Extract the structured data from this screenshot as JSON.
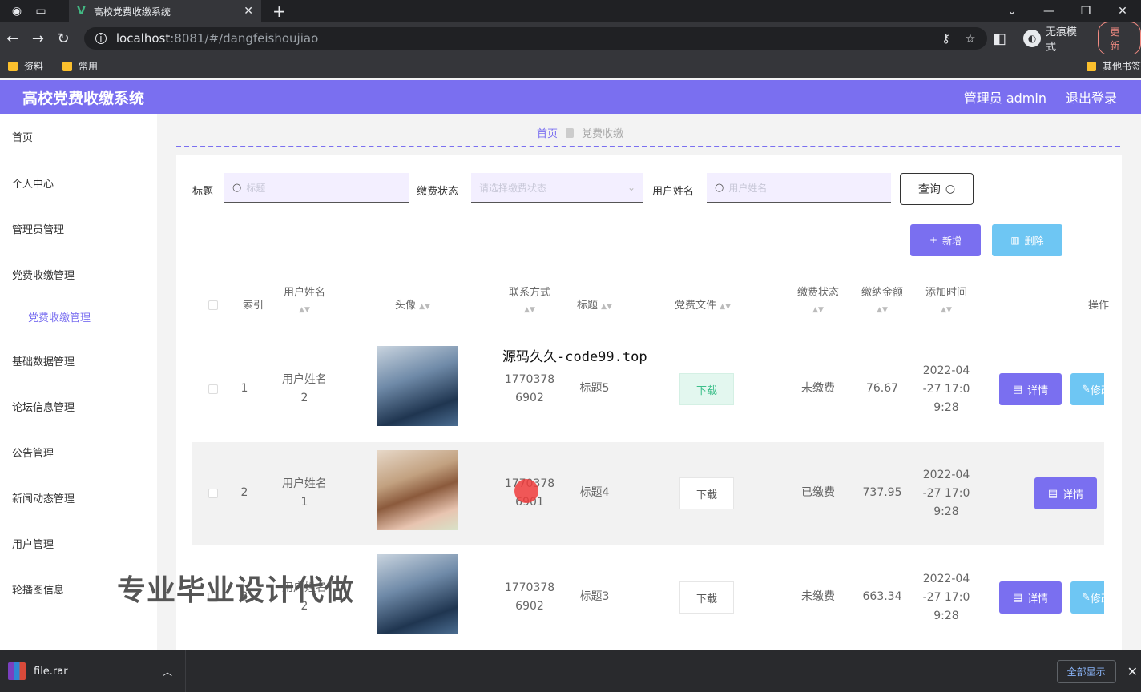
{
  "browser": {
    "tab_title": "高校党费收缴系统",
    "url_host": "localhost",
    "url_path": ":8081/#/dangfeishoujiao",
    "incognito_label": "无痕模式",
    "update_label": "更新",
    "bookmarks": [
      "资料",
      "常用"
    ],
    "bookmarks_other": "其他书签"
  },
  "header": {
    "title": "高校党费收缴系统",
    "user": "管理员 admin",
    "logout": "退出登录",
    "accent_color": "#7a6ff0"
  },
  "sidebar": {
    "items": [
      "首页",
      "个人中心",
      "管理员管理",
      "党费收缴管理",
      "党费收缴管理",
      "基础数据管理",
      "论坛信息管理",
      "公告管理",
      "新闻动态管理",
      "用户管理",
      "轮播图信息"
    ]
  },
  "breadcrumb": {
    "home": "首页",
    "current": "党费收缴"
  },
  "search": {
    "title_label": "标题",
    "title_placeholder": "标题",
    "status_label": "缴费状态",
    "status_placeholder": "请选择缴费状态",
    "name_label": "用户姓名",
    "name_placeholder": "用户姓名",
    "query_label": "查询"
  },
  "actions": {
    "add": "新增",
    "delete": "删除"
  },
  "table": {
    "headers": {
      "index": "索引",
      "username": "用户姓名",
      "avatar": "头像",
      "contact": "联系方式",
      "title": "标题",
      "file": "党费文件",
      "status": "缴费状态",
      "amount": "缴纳金额",
      "time": "添加时间",
      "ops": "操作"
    },
    "rows": [
      {
        "index": "1",
        "username_a": "用户姓名",
        "username_b": "2",
        "contact_a": "1770378",
        "contact_b": "6902",
        "title": "标题5",
        "file": "下载",
        "status": "未缴费",
        "amount": "76.67",
        "time_a": "2022-04",
        "time_b": "-27 17:0",
        "time_c": "9:28",
        "detail": "详情",
        "edit": "修改"
      },
      {
        "index": "2",
        "username_a": "用户姓名",
        "username_b": "1",
        "contact_a": "1770378",
        "contact_b": "6901",
        "title": "标题4",
        "file": "下载",
        "status": "已缴费",
        "amount": "737.95",
        "time_a": "2022-04",
        "time_b": "-27 17:0",
        "time_c": "9:28",
        "detail": "详情"
      },
      {
        "index": "3",
        "username_a": "用户姓名",
        "username_b": "2",
        "contact_a": "1770378",
        "contact_b": "6902",
        "title": "标题3",
        "file": "下载",
        "status": "未缴费",
        "amount": "663.34",
        "time_a": "2022-04",
        "time_b": "-27 17:0",
        "time_c": "9:28",
        "detail": "详情",
        "edit": "修改"
      }
    ]
  },
  "overlays": {
    "source_text": "源码久久-code99.top",
    "big_text": "专业毕业设计代做"
  },
  "download_bar": {
    "file": "file.rar",
    "show_all": "全部显示"
  }
}
